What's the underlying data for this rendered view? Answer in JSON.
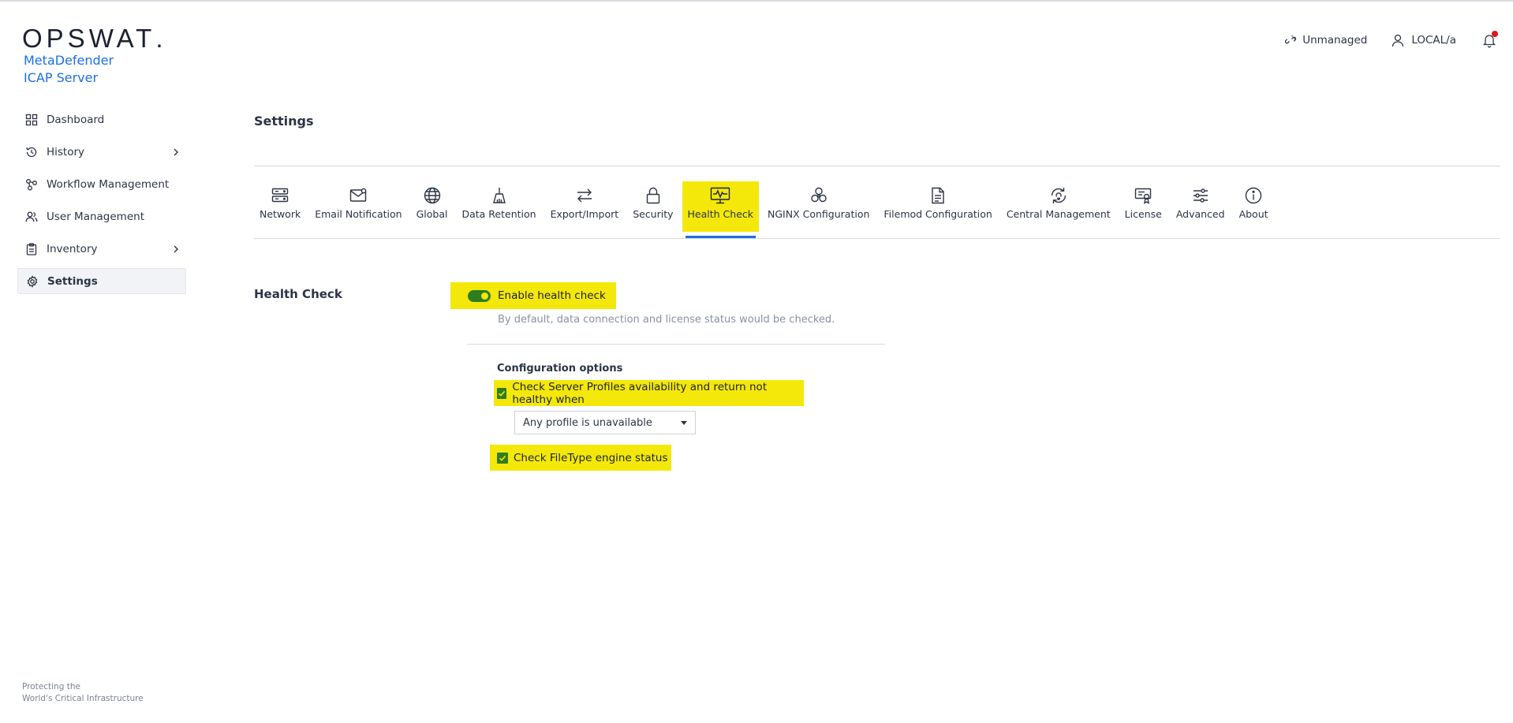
{
  "brand": {
    "logo_text": "OPSWAT",
    "logo_dot": ".",
    "product_line1": "MetaDefender",
    "product_line2": "ICAP Server",
    "tagline_line1": "Protecting the",
    "tagline_line2": "World's Critical Infrastructure"
  },
  "sidebar": {
    "items": [
      {
        "label": "Dashboard",
        "icon": "dashboard-grid-icon"
      },
      {
        "label": "History",
        "icon": "history-icon",
        "has_children": true
      },
      {
        "label": "Workflow Management",
        "icon": "workflow-icon"
      },
      {
        "label": "User Management",
        "icon": "users-icon"
      },
      {
        "label": "Inventory",
        "icon": "clipboard-icon",
        "has_children": true
      },
      {
        "label": "Settings",
        "icon": "gear-icon",
        "active": true
      }
    ]
  },
  "header": {
    "unmanaged_label": "Unmanaged",
    "user_label": "LOCAL/a",
    "notification_badge_color": "#e0141e"
  },
  "page": {
    "title": "Settings"
  },
  "tabs": [
    {
      "label": "Network",
      "icon": "server-icon"
    },
    {
      "label": "Email Notification",
      "icon": "email-icon"
    },
    {
      "label": "Global",
      "icon": "globe-icon"
    },
    {
      "label": "Data Retention",
      "icon": "broom-icon"
    },
    {
      "label": "Export/Import",
      "icon": "arrows-swap-icon"
    },
    {
      "label": "Security",
      "icon": "lock-icon"
    },
    {
      "label": "Health Check",
      "icon": "monitor-pulse-icon",
      "active": true
    },
    {
      "label": "NGINX Configuration",
      "icon": "nodes-icon"
    },
    {
      "label": "Filemod Configuration",
      "icon": "document-icon"
    },
    {
      "label": "Central Management",
      "icon": "sync-bulb-icon"
    },
    {
      "label": "License",
      "icon": "certificate-icon"
    },
    {
      "label": "Advanced",
      "icon": "sliders-icon"
    },
    {
      "label": "About",
      "icon": "info-icon"
    }
  ],
  "health_check": {
    "section_label": "Health Check",
    "enable_label": "Enable health check",
    "enabled": true,
    "hint": "By default, data connection and license status would be checked.",
    "config_title": "Configuration options",
    "check_profiles_label": "Check Server Profiles availability and return not healthy when",
    "check_profiles_checked": true,
    "profile_condition_value": "Any profile is unavailable",
    "check_filetype_label": "Check FileType engine status",
    "check_filetype_checked": true
  },
  "colors": {
    "accent": "#1d6fe0",
    "highlight": "#f4e80a",
    "toggle_on": "#2e7d1f",
    "text": "#2b3445"
  }
}
